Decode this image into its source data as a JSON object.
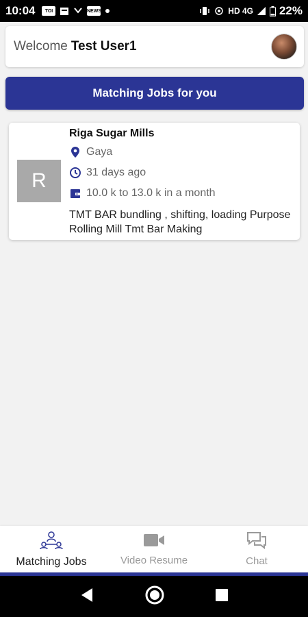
{
  "status_bar": {
    "time": "10:04",
    "notif_icons": [
      "toi-icon",
      "calendar-icon",
      "missed-call-icon",
      "news-icon",
      "dot-icon"
    ],
    "toi_label": "TOI",
    "news_label": "NEWS",
    "network_label": "HD 4G",
    "battery": "22%"
  },
  "header": {
    "welcome_prefix": "Welcome",
    "user_name": "Test User1"
  },
  "banner": {
    "title": "Matching Jobs for you"
  },
  "jobs": [
    {
      "logo_letter": "R",
      "company": "Riga Sugar Mills",
      "location": "Gaya",
      "posted": "31 days ago",
      "salary": "10.0 k to 13.0 k in a month",
      "description": "TMT BAR bundling , shifting, loading Purpose Rolling Mill Tmt Bar Making"
    }
  ],
  "bottom_nav": {
    "items": [
      {
        "label": "Matching Jobs",
        "icon": "matching-jobs-icon",
        "active": true
      },
      {
        "label": "Video Resume",
        "icon": "video-camera-icon",
        "active": false
      },
      {
        "label": "Chat",
        "icon": "chat-icon",
        "active": false
      }
    ]
  },
  "colors": {
    "primary": "#2b3595",
    "card_bg": "#ffffff",
    "page_bg": "#f2f2f2"
  }
}
